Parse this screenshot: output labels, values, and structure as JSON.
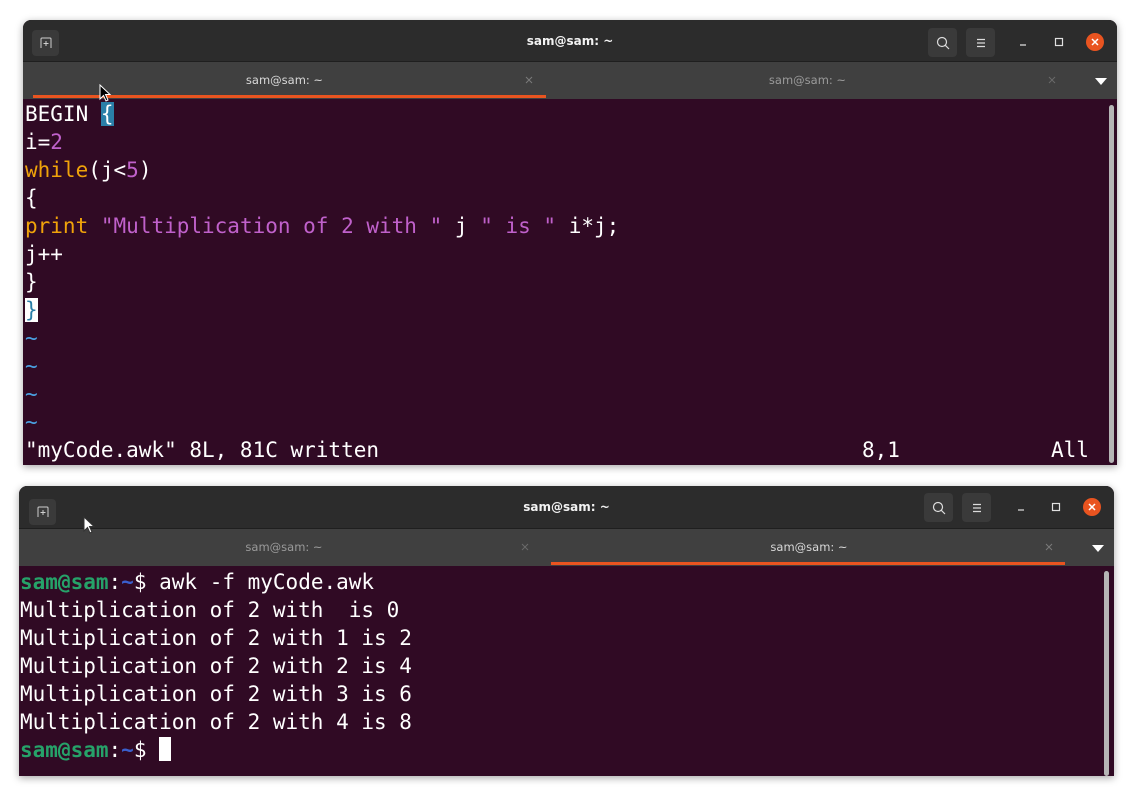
{
  "window_top": {
    "title": "sam@sam: ~",
    "tabs": [
      {
        "label": "sam@sam: ~",
        "active": true
      },
      {
        "label": "sam@sam: ~",
        "active": false
      }
    ],
    "editor_lines": [
      {
        "parts": [
          {
            "t": "BEGIN ",
            "c": ""
          },
          {
            "t": "{",
            "c": "cursor-hl"
          }
        ]
      },
      {
        "parts": [
          {
            "t": "i=",
            "c": ""
          },
          {
            "t": "2",
            "c": "num"
          }
        ]
      },
      {
        "parts": [
          {
            "t": "while",
            "c": "kw"
          },
          {
            "t": "(j<",
            "c": ""
          },
          {
            "t": "5",
            "c": "num"
          },
          {
            "t": ")",
            "c": ""
          }
        ]
      },
      {
        "parts": [
          {
            "t": "{",
            "c": ""
          }
        ]
      },
      {
        "parts": [
          {
            "t": "print",
            "c": "kw"
          },
          {
            "t": " ",
            "c": ""
          },
          {
            "t": "\"Multiplication of 2 with \"",
            "c": "str"
          },
          {
            "t": " j ",
            "c": ""
          },
          {
            "t": "\" is \"",
            "c": "str"
          },
          {
            "t": " i*j;",
            "c": ""
          }
        ]
      },
      {
        "parts": [
          {
            "t": "j++",
            "c": ""
          }
        ]
      },
      {
        "parts": [
          {
            "t": "}",
            "c": ""
          }
        ]
      },
      {
        "parts": [
          {
            "t": "}",
            "c": "cursor-hl2"
          }
        ]
      },
      {
        "parts": [
          {
            "t": "~",
            "c": "tilde"
          }
        ]
      },
      {
        "parts": [
          {
            "t": "~",
            "c": "tilde"
          }
        ]
      },
      {
        "parts": [
          {
            "t": "~",
            "c": "tilde"
          }
        ]
      },
      {
        "parts": [
          {
            "t": "~",
            "c": "tilde"
          }
        ]
      }
    ],
    "status": {
      "message": "\"myCode.awk\" 8L, 81C written",
      "position": "8,1",
      "scroll": "All"
    }
  },
  "window_bottom": {
    "title": "sam@sam: ~",
    "tabs": [
      {
        "label": "sam@sam: ~",
        "active": false
      },
      {
        "label": "sam@sam: ~",
        "active": true
      }
    ],
    "prompt_user": "sam@sam",
    "prompt_sep": ":",
    "prompt_path": "~",
    "prompt_symbol": "$ ",
    "command": "awk -f myCode.awk",
    "output": [
      "Multiplication of 2 with  is 0",
      "Multiplication of 2 with 1 is 2",
      "Multiplication of 2 with 2 is 4",
      "Multiplication of 2 with 3 is 6",
      "Multiplication of 2 with 4 is 8"
    ]
  },
  "colors": {
    "terminal_bg": "#300a24",
    "accent": "#e95420",
    "keyword": "#f0a30a",
    "string": "#c061cb",
    "prompt_user": "#26a269",
    "prompt_path": "#3a5fcd"
  }
}
